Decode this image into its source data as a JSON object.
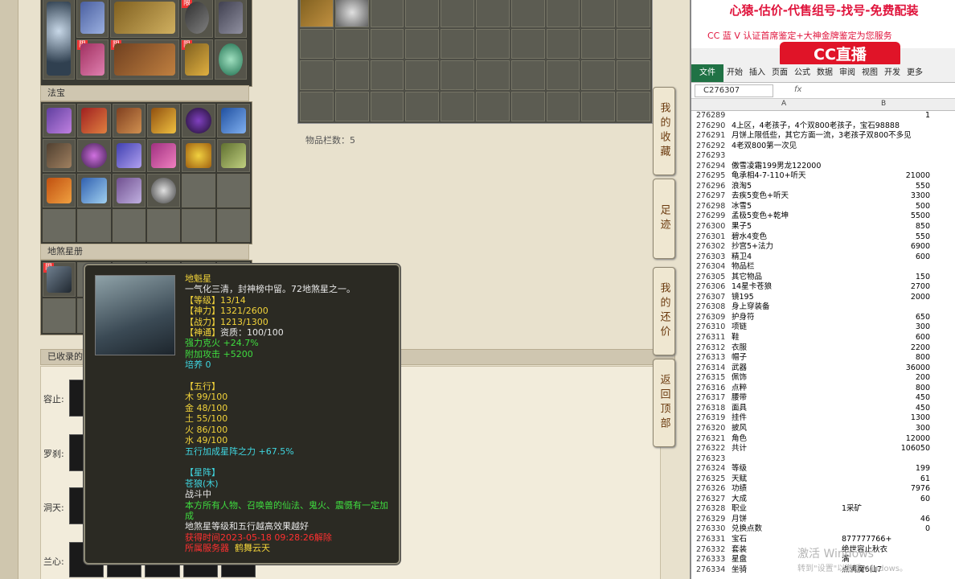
{
  "game": {
    "sections": {
      "fabao": "法宝",
      "disha": "地煞星册",
      "collected": "已收录的"
    },
    "xian_badge": "限",
    "inventory_count": "物品栏数：5",
    "side_buttons": [
      "我的收藏",
      "足迹",
      "我的还价",
      "返回顶部"
    ],
    "collected_labels": [
      "容止:",
      "罗刹:",
      "洞天:",
      "兰心:"
    ]
  },
  "tooltip": {
    "name": "地魁星",
    "desc": "一气化三清，封神榜中留。72地煞星之一。",
    "level": "【等级】13/14",
    "shenli": "【神力】1321/2600",
    "zhanli": "【战力】1213/1300",
    "shentong": "【神通】",
    "zizhi": "资质：100/100",
    "qianghua": "强力克火 +24.7%",
    "fujia": "附加攻击 +5200",
    "peiyang": "培养 0",
    "wuxing_title": "【五行】",
    "wuxing": [
      "木 99/100",
      "金 48/100",
      "土 55/100",
      "火 86/100",
      "水 49/100"
    ],
    "wuxing_bonus": "五行加成星阵之力 +67.5%",
    "xingzhen_title": "【星阵】",
    "xingzhen": "苍狼(木)",
    "zhandou": "战斗中",
    "effect": "本方所有人物、召唤兽的仙法、鬼火、震慑有一定加成",
    "note": "地煞星等级和五行越高效果越好",
    "time": "2023-05-18 09:28:26",
    "time_prefix": "获得时间",
    "time_suffix": "解除",
    "server_label": "所属服务器",
    "server": "鹤舞云天"
  },
  "excel": {
    "ad_line1": "心猿-估价-代售组号-找号-免费配装",
    "ad_line2": "CC 蓝 V 认证首席鉴定+大神金牌鉴定为您服务",
    "logo": "CC直播",
    "tabs": [
      "文件",
      "开始",
      "插入",
      "页面",
      "公式",
      "数据",
      "审阅",
      "视图",
      "开发",
      "更多"
    ],
    "namebox": "C276307",
    "fx": "fx",
    "col_a": "A",
    "col_b": "B",
    "rows": [
      [
        "276289",
        "",
        "1"
      ],
      [
        "276290",
        "4上区，4老孩子，4个双800老孩子，宝石98888",
        ""
      ],
      [
        "276291",
        "月饼上限低些，其它方面一流，3老孩子双800不多见",
        ""
      ],
      [
        "276292",
        "4老双800第一次见",
        ""
      ],
      [
        "276293",
        "",
        ""
      ],
      [
        "276294",
        "傲雪凌霜199男龙122000",
        ""
      ],
      [
        "276295",
        "龟承相4-7-110+听天",
        "21000"
      ],
      [
        "276296",
        "浪淘5",
        "550"
      ],
      [
        "276297",
        "去疾5变色+听天",
        "3300"
      ],
      [
        "276298",
        "冰雪5",
        "500"
      ],
      [
        "276299",
        "孟极5变色+乾坤",
        "5500"
      ],
      [
        "276300",
        "果子5",
        "850"
      ],
      [
        "276301",
        "碧水4变色",
        "550"
      ],
      [
        "276302",
        "抄宫5+法力",
        "6900"
      ],
      [
        "276303",
        "精卫4",
        "600"
      ],
      [
        "276304",
        "物品栏",
        ""
      ],
      [
        "276305",
        "其它物品",
        "150"
      ],
      [
        "276306",
        "14星卡苍狼",
        "2700"
      ],
      [
        "276307",
        "镜195",
        "2000"
      ],
      [
        "276308",
        "身上穿装备",
        ""
      ],
      [
        "276309",
        "护身符",
        "650"
      ],
      [
        "276310",
        "项链",
        "300"
      ],
      [
        "276311",
        "鞋",
        "600"
      ],
      [
        "276312",
        "衣服",
        "2200"
      ],
      [
        "276313",
        "帽子",
        "800"
      ],
      [
        "276314",
        "武器",
        "36000"
      ],
      [
        "276315",
        "佩饰",
        "200"
      ],
      [
        "276316",
        "点粹",
        "800"
      ],
      [
        "276317",
        "腰带",
        "450"
      ],
      [
        "276318",
        "面具",
        "450"
      ],
      [
        "276319",
        "挂件",
        "1300"
      ],
      [
        "276320",
        "披风",
        "300"
      ],
      [
        "276321",
        "角色",
        "12000"
      ],
      [
        "276322",
        "共计",
        "106050"
      ],
      [
        "276323",
        "",
        ""
      ],
      [
        "276324",
        "等级",
        "199"
      ],
      [
        "276325",
        "天赋",
        "61"
      ],
      [
        "276326",
        "功绩",
        "7976"
      ],
      [
        "276327",
        "大成",
        "60"
      ],
      [
        "276328",
        "职业",
        "1采矿"
      ],
      [
        "276329",
        "月饼",
        "46"
      ],
      [
        "276330",
        "兑换点数",
        "0"
      ],
      [
        "276331",
        "宝石",
        "877777766+"
      ],
      [
        "276332",
        "套装",
        "绝世容止秋衣"
      ],
      [
        "276333",
        "星盘",
        "满"
      ],
      [
        "276334",
        "坐骑",
        "点满魔6仙7"
      ]
    ],
    "watermark1": "激活 Windows",
    "watermark2": "转到\"设置\"以激活 Windows。"
  }
}
